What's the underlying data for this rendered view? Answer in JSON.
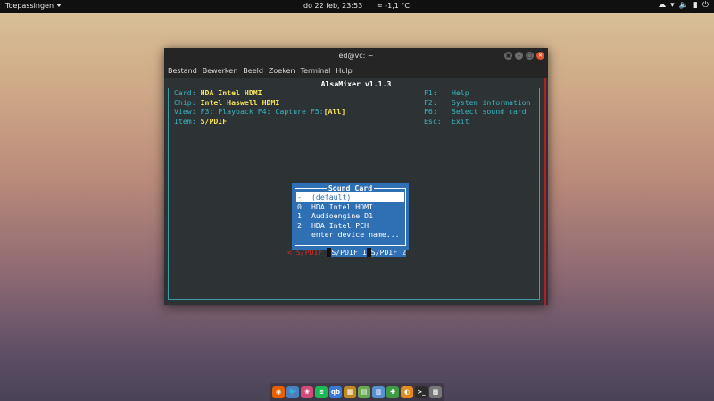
{
  "topbar": {
    "apps_label": "Toepassingen",
    "clock": "do 22 feb, 23:53",
    "weather": "-1,1 °C",
    "tray": [
      "☁",
      "▾",
      "🔈",
      "▮",
      "⏻"
    ]
  },
  "window": {
    "title": "ed@vc: ~",
    "menu": [
      "Bestand",
      "Bewerken",
      "Beeld",
      "Zoeken",
      "Terminal",
      "Hulp"
    ]
  },
  "alsamixer": {
    "title": "AlsaMixer v1.1.3",
    "card_label": "Card:",
    "card_value": "HDA Intel HDMI",
    "chip_label": "Chip:",
    "chip_value": "Intel Haswell HDMI",
    "view_label": "View:",
    "view_options": "F3: Playback  F4: Capture  F5:",
    "view_selected": "[All]",
    "item_label": "Item:",
    "item_value": "S/PDIF",
    "keys": [
      {
        "key": "F1:",
        "desc": "Help"
      },
      {
        "key": "F2:",
        "desc": "System information"
      },
      {
        "key": "F6:",
        "desc": "Select sound card"
      },
      {
        "key": "Esc:",
        "desc": "Exit"
      }
    ],
    "dialog_title": "Sound Card",
    "dialog_items": [
      {
        "num": "-",
        "name": "(default)"
      },
      {
        "num": "0",
        "name": "HDA Intel HDMI"
      },
      {
        "num": "1",
        "name": "Audioengine D1"
      },
      {
        "num": "2",
        "name": "HDA Intel PCH"
      },
      {
        "num": "",
        "name": "enter device name..."
      }
    ],
    "controls": {
      "prefix": "< S/PDIF ",
      "mid1": "S/PDIF 1",
      "mid2": "S/PDIF 2"
    }
  },
  "dock": {
    "icons": [
      {
        "name": "firefox",
        "glyph": "◉",
        "color": "#e66000"
      },
      {
        "name": "bird",
        "glyph": "🐦",
        "color": "#4a7fc1"
      },
      {
        "name": "app3",
        "glyph": "❀",
        "color": "#d04a7a"
      },
      {
        "name": "spotify",
        "glyph": "≋",
        "color": "#1db954"
      },
      {
        "name": "qbittorrent",
        "glyph": "qb",
        "color": "#3a7bd5"
      },
      {
        "name": "app6",
        "glyph": "▦",
        "color": "#c08a20"
      },
      {
        "name": "app7",
        "glyph": "▤",
        "color": "#6aa84f"
      },
      {
        "name": "app8",
        "glyph": "▥",
        "color": "#5a8fd0"
      },
      {
        "name": "app9",
        "glyph": "✚",
        "color": "#3d9b45"
      },
      {
        "name": "app10",
        "glyph": "◐",
        "color": "#e08a20"
      },
      {
        "name": "terminal",
        "glyph": ">_",
        "color": "#2b2b2b"
      },
      {
        "name": "app12",
        "glyph": "▩",
        "color": "#777777"
      }
    ]
  }
}
